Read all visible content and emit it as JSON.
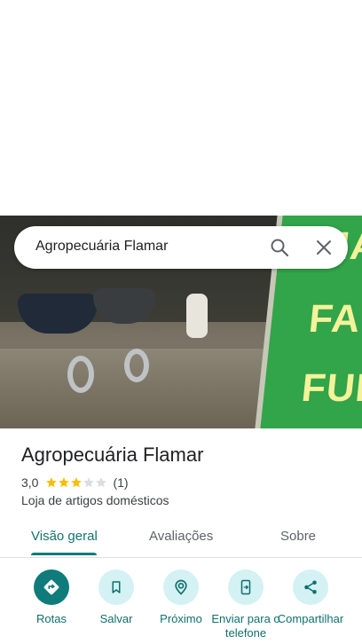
{
  "search": {
    "query": "Agropecuária Flamar"
  },
  "sign": {
    "line1": "MA",
    "line2": "FAR",
    "line3": "FUR"
  },
  "place": {
    "title": "Agropecuária Flamar",
    "rating": "3,0",
    "rating_value": 3,
    "rating_max": 5,
    "review_count": "(1)",
    "category": "Loja de artigos domésticos"
  },
  "tabs": [
    {
      "label": "Visão geral",
      "active": true
    },
    {
      "label": "Avaliações",
      "active": false
    },
    {
      "label": "Sobre",
      "active": false
    }
  ],
  "actions": [
    {
      "label": "Rotas",
      "icon": "directions-icon"
    },
    {
      "label": "Salvar",
      "icon": "bookmark-icon"
    },
    {
      "label": "Próximo",
      "icon": "nearby-icon"
    },
    {
      "label": "Enviar para o telefone",
      "icon": "send-to-phone-icon"
    },
    {
      "label": "Compartilhar",
      "icon": "share-icon"
    }
  ],
  "colors": {
    "accent": "#0f7b7b",
    "action_bg": "#d4f1f4",
    "star": "#fbbc04",
    "star_empty": "#dadce0"
  }
}
